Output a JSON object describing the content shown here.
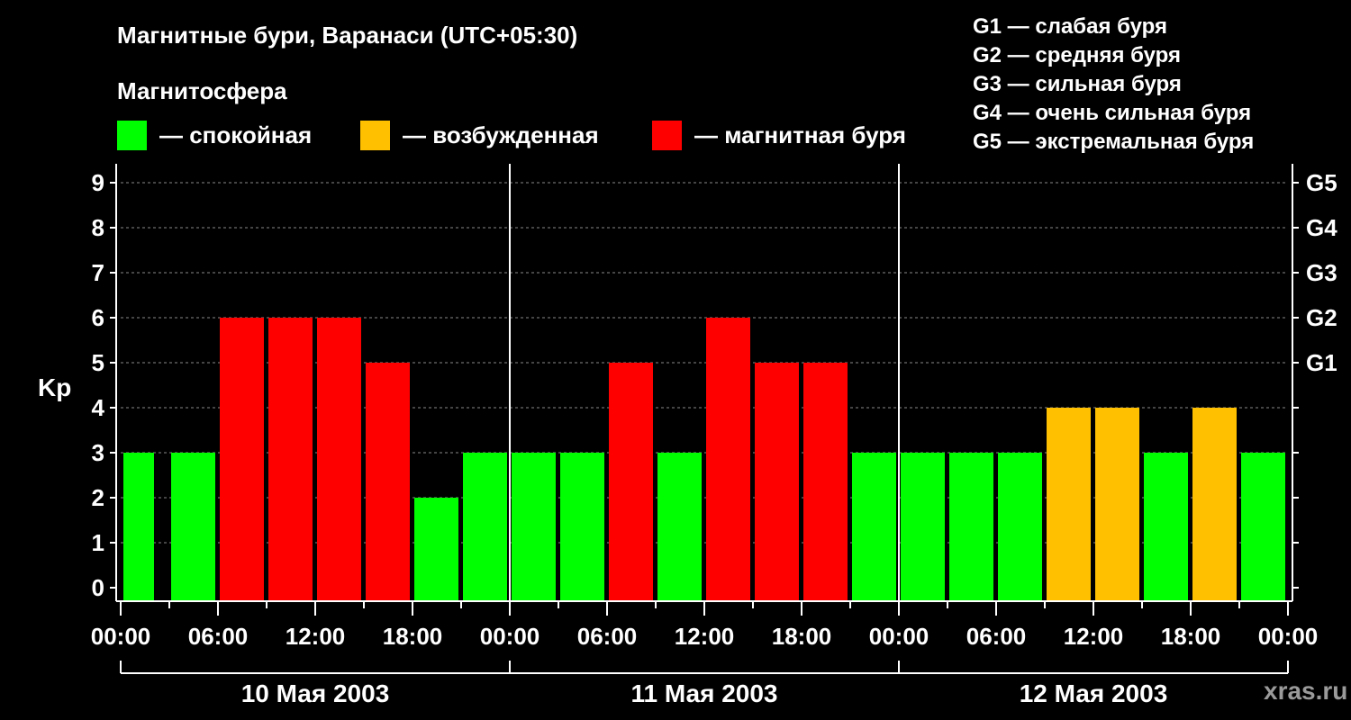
{
  "chart_data": {
    "type": "bar",
    "title": "Магнитные бури, Варанаси (UTC+05:30)",
    "subtitle": "Магнитосфера",
    "ylabel": "Kp",
    "ylim": [
      0,
      9
    ],
    "y_ticks": [
      "0",
      "1",
      "2",
      "3",
      "4",
      "5",
      "6",
      "7",
      "8",
      "9"
    ],
    "storm_levels": [
      {
        "kp": 5,
        "label": "G1"
      },
      {
        "kp": 6,
        "label": "G2"
      },
      {
        "kp": 7,
        "label": "G3"
      },
      {
        "kp": 8,
        "label": "G4"
      },
      {
        "kp": 9,
        "label": "G5"
      }
    ],
    "legend": [
      {
        "label": "— спокойная",
        "color": "#00ff00"
      },
      {
        "label": "— возбужденная",
        "color": "#ffc000"
      },
      {
        "label": "— магнитная буря",
        "color": "#ff0000"
      }
    ],
    "g_scale": [
      "G1 — слабая буря",
      "G2 — средняя буря",
      "G3 — сильная буря",
      "G4 — очень сильная буря",
      "G5 — экстремальная буря"
    ],
    "x_tick_labels": [
      "00:00",
      "06:00",
      "12:00",
      "18:00",
      "00:00",
      "06:00",
      "12:00",
      "18:00",
      "00:00",
      "06:00",
      "12:00",
      "18:00",
      "00:00"
    ],
    "days": [
      "10 Мая 2003",
      "11 Мая 2003",
      "12 Мая 2003"
    ],
    "interval_hours": 3,
    "values": [
      3,
      3,
      6,
      6,
      6,
      5,
      2,
      3,
      3,
      3,
      5,
      3,
      6,
      5,
      5,
      3,
      3,
      3,
      3,
      4,
      4,
      3,
      4,
      3
    ],
    "categories": [
      "10 Мая 2003 00:00",
      "10 Мая 2003 03:00",
      "10 Мая 2003 06:00",
      "10 Мая 2003 09:00",
      "10 Мая 2003 12:00",
      "10 Мая 2003 15:00",
      "10 Мая 2003 18:00",
      "10 Мая 2003 21:00",
      "11 Мая 2003 00:00",
      "11 Мая 2003 03:00",
      "11 Мая 2003 06:00",
      "11 Мая 2003 09:00",
      "11 Мая 2003 12:00",
      "11 Мая 2003 15:00",
      "11 Мая 2003 18:00",
      "11 Мая 2003 21:00",
      "12 Мая 2003 00:00",
      "12 Мая 2003 03:00",
      "12 Мая 2003 06:00",
      "12 Мая 2003 09:00",
      "12 Мая 2003 12:00",
      "12 Мая 2003 15:00",
      "12 Мая 2003 18:00",
      "12 Мая 2003 21:00"
    ],
    "level_colors": {
      "quiet": "#00ff00",
      "active": "#ffc000",
      "storm": "#ff0000"
    },
    "grid": true
  },
  "credit": "xras.ru"
}
